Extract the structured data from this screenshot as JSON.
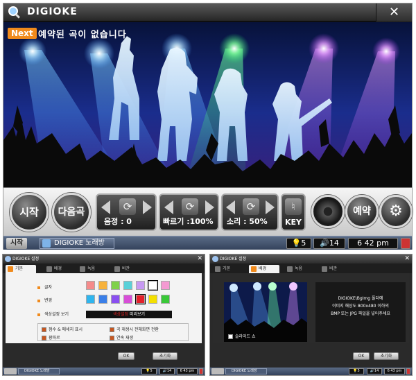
{
  "main": {
    "title": "DIGIOKE",
    "close_glyph": "✕",
    "next_badge": "Next",
    "next_text": "예약된 곡이 없습니다",
    "controls": {
      "start": "시작",
      "next_song": "다음곡",
      "pitch_label": "음정 : 0",
      "speed_label": "빠르기 :100%",
      "volume_label": "소리 : 50%",
      "key_label": "KEY",
      "reserve": "예약",
      "settings_glyph": "⚙"
    },
    "taskbar": {
      "start": "시작",
      "task": "DIGIOKE 노래방",
      "bulb_count": "5",
      "volume": "14",
      "clock": "6 42 pm"
    }
  },
  "settings_dialog": {
    "title": "DIGIOKE 설정",
    "close_glyph": "✕",
    "tabs": [
      {
        "label": "기본"
      },
      {
        "label": "배경"
      },
      {
        "label": "녹음"
      },
      {
        "label": "비관"
      }
    ],
    "rows": {
      "lyrics": "글자",
      "outline": "변경",
      "color_preview": "색상설정 보기"
    },
    "preview_text_a": "색상설정",
    "preview_text_b": "미리보기",
    "checkboxes": [
      {
        "label": "점수 & 메세지 표시",
        "checked": true
      },
      {
        "label": "곡 재생시 전체화면 전환",
        "checked": true
      },
      {
        "label": "팡파르",
        "checked": true
      },
      {
        "label": "연속 재생",
        "checked": true
      }
    ],
    "ok": "OK",
    "reset": "초기화",
    "mini_taskbar": {
      "task": "DIGIOKE 노래방",
      "bulb_count": "5",
      "volume": "14",
      "clock": "6 43 pm"
    }
  },
  "settings_dialog_2": {
    "title": "DIGIOKE 설정",
    "slideshow_label": "슬라이드 쇼",
    "slideshow_checked": false,
    "info_lines": [
      "DIGIOKE\\BgImg 폴더에",
      "이미지 해상도 800x480 이하의",
      "BMP 또는 JPG 파일을 넣어주세요"
    ],
    "ok": "OK",
    "reset": "초기화",
    "mini_taskbar": {
      "task": "DIGIOKE 노래방",
      "bulb_count": "5",
      "volume": "14",
      "clock": "6 43 pm"
    }
  },
  "colors": {
    "lyric_swatches": [
      "#f58b8b",
      "#f7b23c",
      "#7fd14a",
      "#5ad0d8",
      "#c79af3",
      "#ffffff",
      "#f49ad2"
    ],
    "outline_swatches": [
      "#2fb5ee",
      "#3a7fe8",
      "#8a4ff0",
      "#d84fd8",
      "#e4202a",
      "#f4e000",
      "#39c838"
    ],
    "accent": "#f08a1c"
  }
}
